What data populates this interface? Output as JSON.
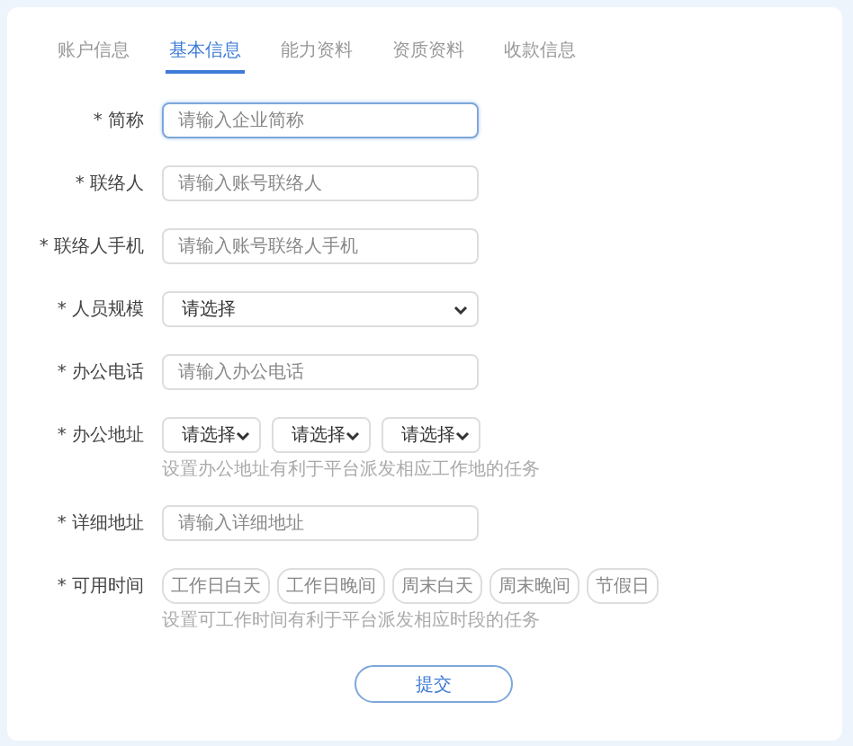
{
  "tabs": [
    {
      "label": "账户信息",
      "selected": false
    },
    {
      "label": "基本信息",
      "selected": true
    },
    {
      "label": "能力资料",
      "selected": false
    },
    {
      "label": "资质资料",
      "selected": false
    },
    {
      "label": "收款信息",
      "selected": false
    }
  ],
  "fields": [
    {
      "kind": "input",
      "label": "* 简称",
      "placeholder": "请输入企业简称",
      "focused": true
    },
    {
      "kind": "input",
      "label": "* 联络人",
      "placeholder": "请输入账号联络人",
      "focused": false
    },
    {
      "kind": "input",
      "label": "* 联络人手机",
      "placeholder": "请输入账号联络人手机",
      "focused": false
    },
    {
      "kind": "select",
      "label": "* 人员规模",
      "selects": [
        "请选择"
      ]
    },
    {
      "kind": "input",
      "label": "* 办公电话",
      "placeholder": "请输入办公电话",
      "focused": false
    },
    {
      "kind": "select",
      "label": "* 办公地址",
      "selects": [
        "请选择",
        "请选择",
        "请选择"
      ],
      "hint": "设置办公地址有利于平台派发相应工作地的任务"
    },
    {
      "kind": "input",
      "label": "* 详细地址",
      "placeholder": "请输入详细地址",
      "focused": false
    },
    {
      "kind": "chips",
      "label": "* 可用时间",
      "chips": [
        {
          "label": "工作日白天",
          "selected": false
        },
        {
          "label": "工作日晚间",
          "selected": false
        },
        {
          "label": "周末白天",
          "selected": false
        },
        {
          "label": "周末晚间",
          "selected": false
        },
        {
          "label": "节假日",
          "selected": false
        }
      ],
      "hint": "设置可工作时间有利于平台派发相应时段的任务"
    }
  ],
  "submit": "提交"
}
